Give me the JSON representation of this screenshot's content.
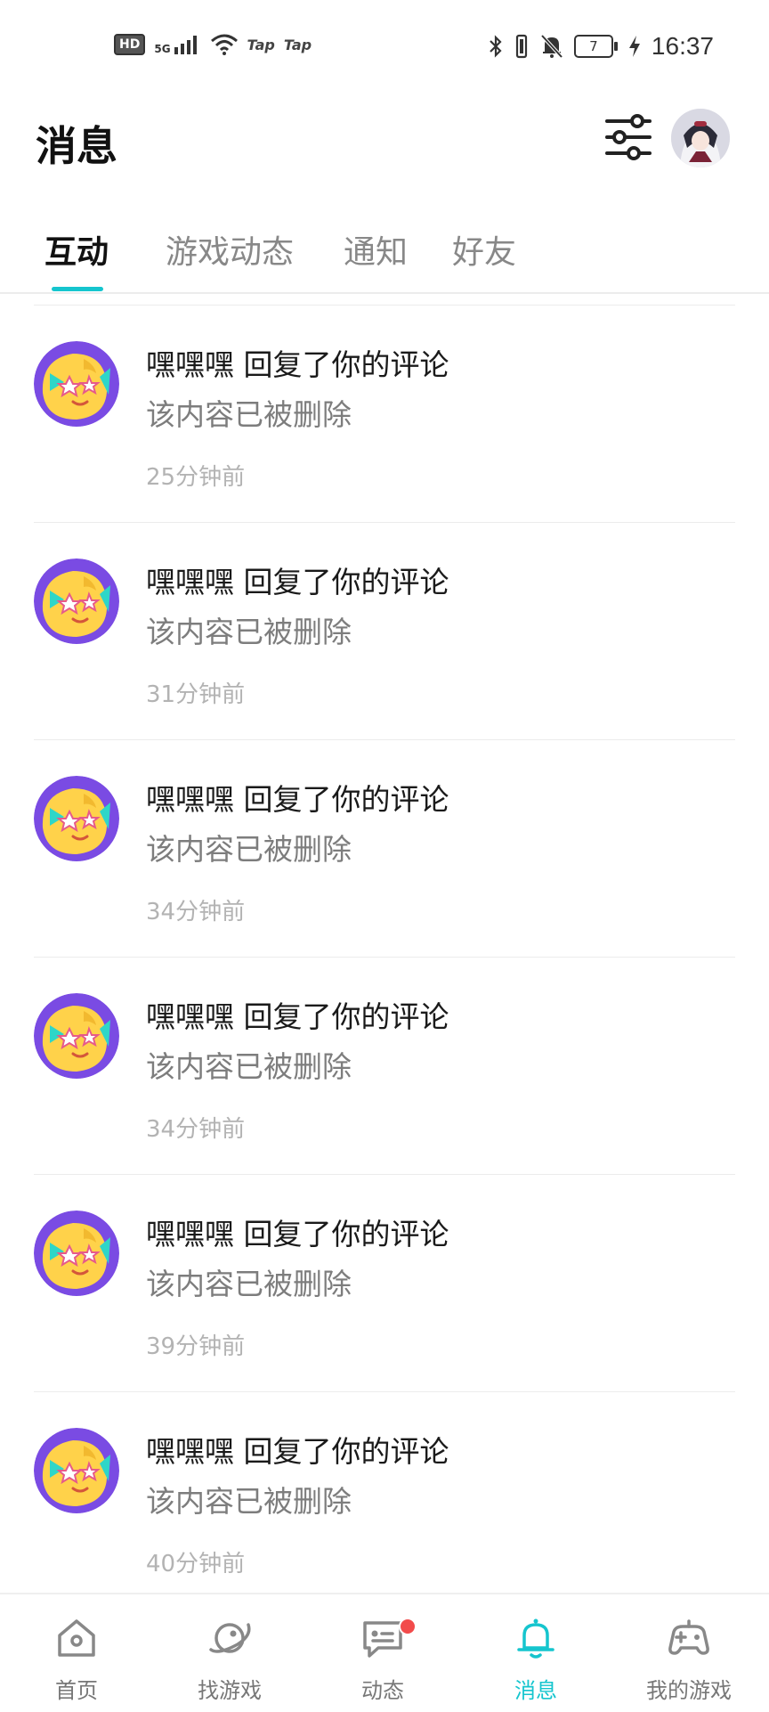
{
  "status_bar": {
    "hd": "HD",
    "network": "5G",
    "app_badges": [
      "Tap",
      "Tap"
    ],
    "battery_level": "7",
    "time": "16:37"
  },
  "header": {
    "title": "消息",
    "filter_icon": "filter-sliders-icon"
  },
  "tabs": [
    {
      "label": "互动",
      "active": true
    },
    {
      "label": "游戏动态",
      "active": false
    },
    {
      "label": "通知",
      "active": false
    },
    {
      "label": "好友",
      "active": false
    }
  ],
  "messages": [
    {
      "title": "嘿嘿嘿 回复了你的评论",
      "body": "该内容已被删除",
      "time": "25分钟前"
    },
    {
      "title": "嘿嘿嘿 回复了你的评论",
      "body": "该内容已被删除",
      "time": "31分钟前"
    },
    {
      "title": "嘿嘿嘿 回复了你的评论",
      "body": "该内容已被删除",
      "time": "34分钟前"
    },
    {
      "title": "嘿嘿嘿 回复了你的评论",
      "body": "该内容已被删除",
      "time": "34分钟前"
    },
    {
      "title": "嘿嘿嘿 回复了你的评论",
      "body": "该内容已被删除",
      "time": "39分钟前"
    },
    {
      "title": "嘿嘿嘿 回复了你的评论",
      "body": "该内容已被删除",
      "time": "40分钟前"
    }
  ],
  "bottom_nav": [
    {
      "label": "首页",
      "icon": "home-icon",
      "active": false
    },
    {
      "label": "找游戏",
      "icon": "planet-icon",
      "active": false
    },
    {
      "label": "动态",
      "icon": "chat-feed-icon",
      "active": false,
      "badge_dot": true
    },
    {
      "label": "消息",
      "icon": "bell-icon",
      "active": true
    },
    {
      "label": "我的游戏",
      "icon": "gamepad-icon",
      "active": false
    }
  ],
  "colors": {
    "accent": "#15c5ce",
    "badge_red": "#f24b4b",
    "avatar_purple": "#7a4be3",
    "avatar_yellow": "#ffd24a"
  }
}
